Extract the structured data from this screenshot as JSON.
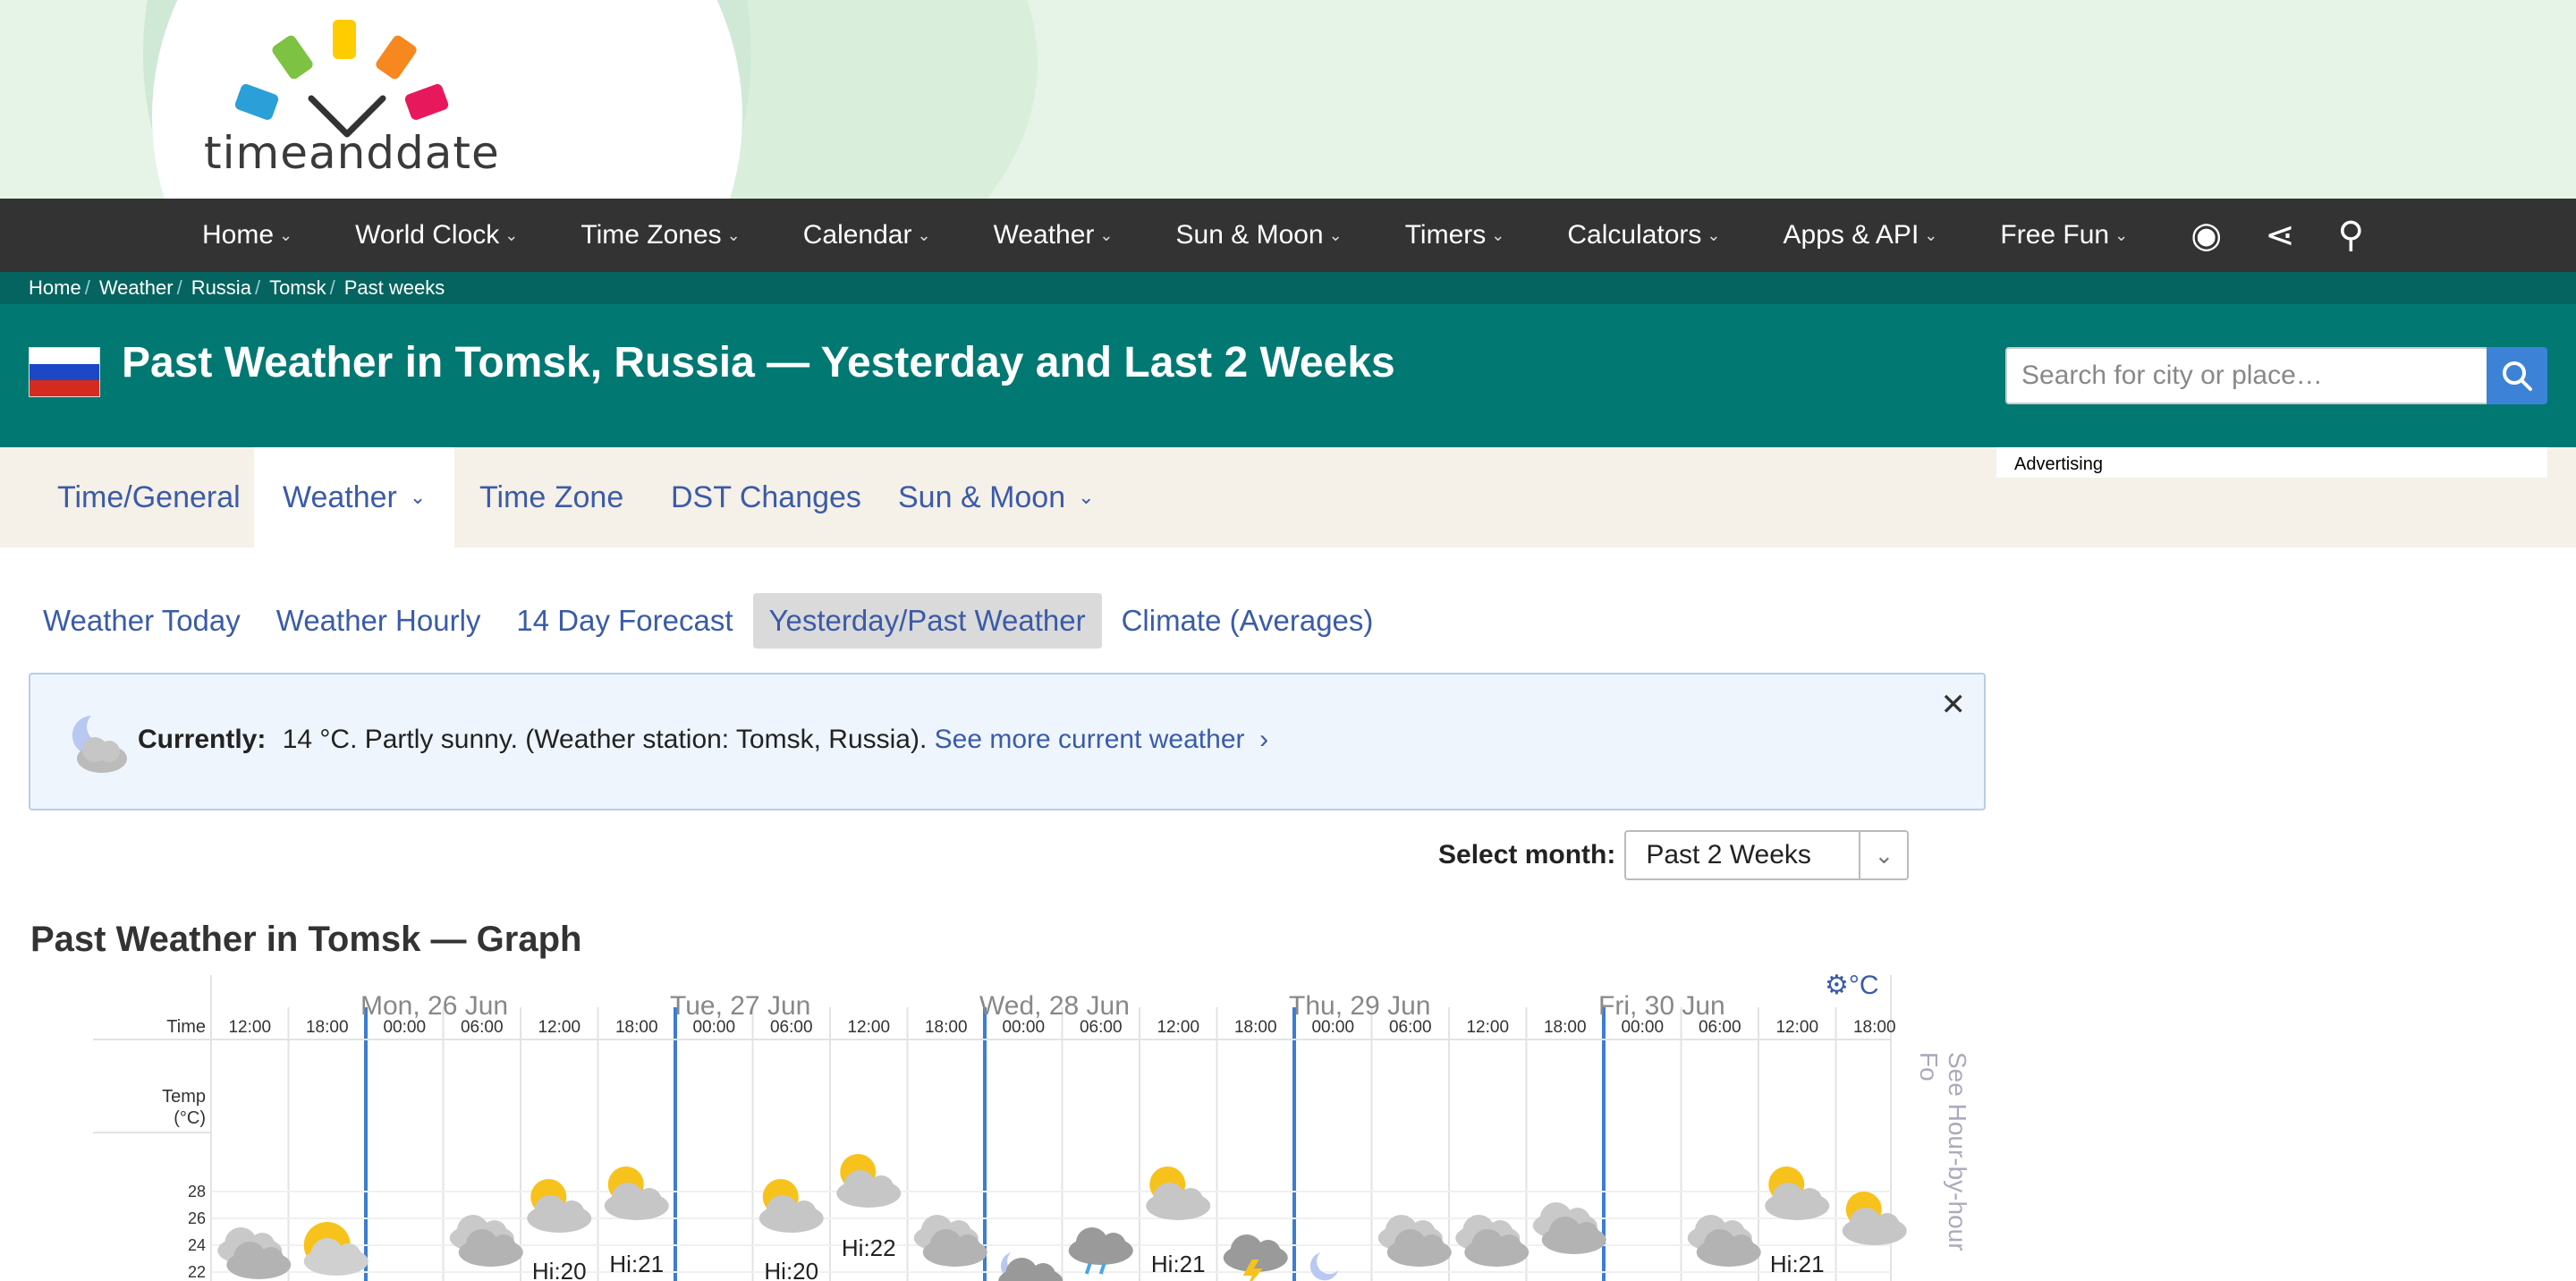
{
  "logo": {
    "text": "timeanddate"
  },
  "nav": {
    "items": [
      "Home",
      "World Clock",
      "Time Zones",
      "Calendar",
      "Weather",
      "Sun & Moon",
      "Timers",
      "Calculators",
      "Apps & API",
      "Free Fun"
    ],
    "icons": [
      "account-icon",
      "share-icon",
      "search-icon"
    ]
  },
  "breadcrumb": [
    "Home",
    "Weather",
    "Russia",
    "Tomsk",
    "Past weeks"
  ],
  "title": "Past Weather in Tomsk, Russia — Yesterday and Last 2 Weeks",
  "search": {
    "placeholder": "Search for city or place…"
  },
  "tabs": [
    "Time/General",
    "Weather",
    "Time Zone",
    "DST Changes",
    "Sun & Moon"
  ],
  "advertising": "Advertising",
  "subnav": [
    "Weather Today",
    "Weather Hourly",
    "14 Day Forecast",
    "Yesterday/Past Weather",
    "Climate (Averages)"
  ],
  "current": {
    "label": "Currently:",
    "text": "14 °C. Partly sunny. (Weather station: Tomsk, Russia).",
    "link": "See more current weather"
  },
  "select": {
    "label": "Select month:",
    "value": "Past 2 Weeks"
  },
  "graph": {
    "title": "Past Weather in Tomsk — Graph",
    "units": "°C",
    "side_link": "See Hour-by-hour Fo",
    "row_labels": {
      "time": "Time",
      "temp": "Temp",
      "temp_unit": "(°C)"
    },
    "days": [
      "Mon, 26 Jun",
      "Tue, 27 Jun",
      "Wed, 28 Jun",
      "Thu, 29 Jun",
      "Fri, 30 Jun"
    ],
    "times": [
      "12:00",
      "18:00",
      "00:00",
      "06:00",
      "12:00",
      "18:00",
      "00:00",
      "06:00",
      "12:00",
      "18:00",
      "00:00",
      "06:00",
      "12:00",
      "18:00",
      "00:00",
      "06:00",
      "12:00",
      "18:00",
      "00:00",
      "06:00",
      "12:00",
      "18:00"
    ],
    "temp_ticks": [
      "28",
      "26",
      "24",
      "22"
    ],
    "highs": [
      {
        "label": "Hi:20",
        "slot": 4
      },
      {
        "label": "Hi:21",
        "slot": 5
      },
      {
        "label": "Hi:20",
        "slot": 7
      },
      {
        "label": "Hi:22",
        "slot": 8
      },
      {
        "label": "Hi:21",
        "slot": 12
      },
      {
        "label": "Hi:21",
        "slot": 20
      }
    ],
    "icons": [
      "cloudy",
      "sunny",
      "",
      "cloudy",
      "partly-cloudy",
      "partly-cloudy",
      "",
      "partly-cloudy",
      "partly-cloudy",
      "cloudy",
      "moon-cloud",
      "rain",
      "partly-cloudy",
      "thunder",
      "moon",
      "cloudy",
      "cloudy",
      "cloudy",
      "",
      "cloudy",
      "partly-cloudy",
      "partly-cloudy"
    ]
  },
  "colors": {
    "accent": "#3a5ba8",
    "teal": "#027873",
    "nav": "#333333"
  }
}
